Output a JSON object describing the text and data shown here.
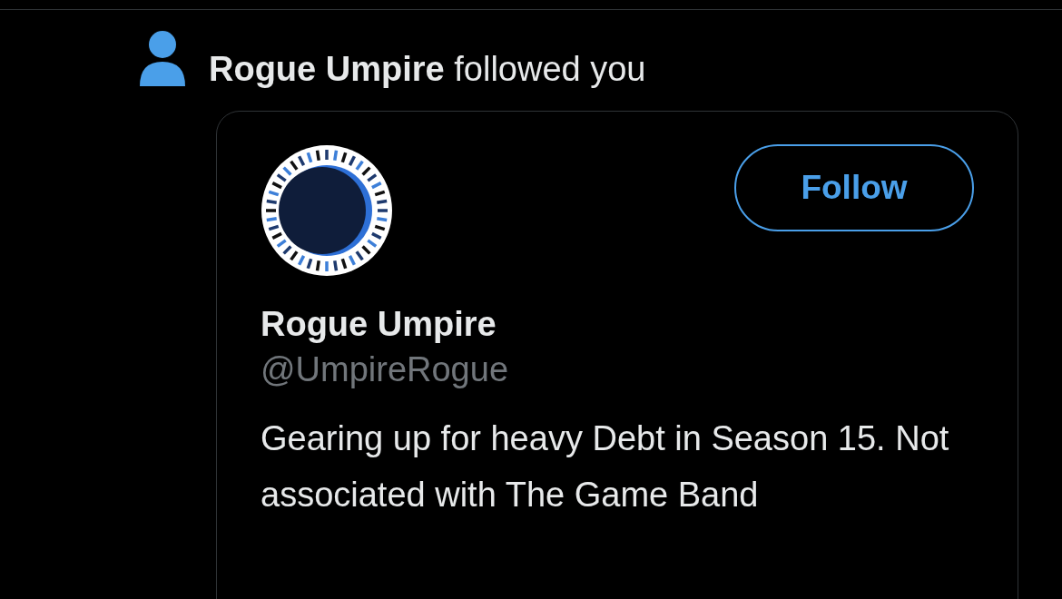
{
  "notification": {
    "text": "**Rogue Umpire** followed you"
  },
  "profile_card": {
    "follow_button": "Follow",
    "name": "Rogue Umpire",
    "handle": "@UmpireRogue",
    "bio": "Gearing up for heavy Debt in Season 15. Not associated with The Game Band"
  }
}
